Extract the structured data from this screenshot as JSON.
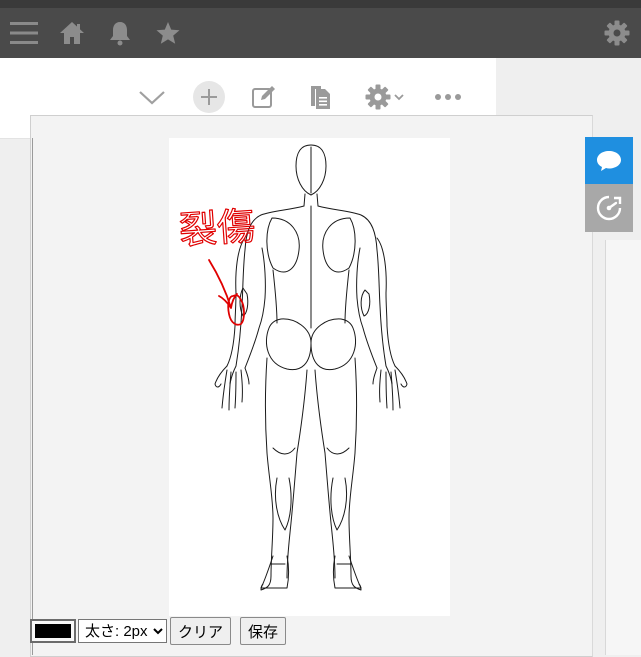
{
  "nav": {
    "icons": [
      "menu-icon",
      "home-icon",
      "bell-icon",
      "star-icon",
      "gear-icon"
    ]
  },
  "toolbar": {
    "icons": [
      "chevron-down-icon",
      "plus-icon",
      "edit-icon",
      "document-icon",
      "gear-icon",
      "more-icon"
    ]
  },
  "canvas": {
    "annotation_text": "裂傷",
    "ink_color": "#e00000"
  },
  "controls": {
    "color_value": "#000000",
    "thickness_options": [
      "太さ: 2px"
    ],
    "thickness_selected": "太さ: 2px",
    "clear_label": "クリア",
    "save_label": "保存"
  },
  "side": {
    "chat_color": "#1f8fe0",
    "speed_color": "#a8a8a8"
  }
}
